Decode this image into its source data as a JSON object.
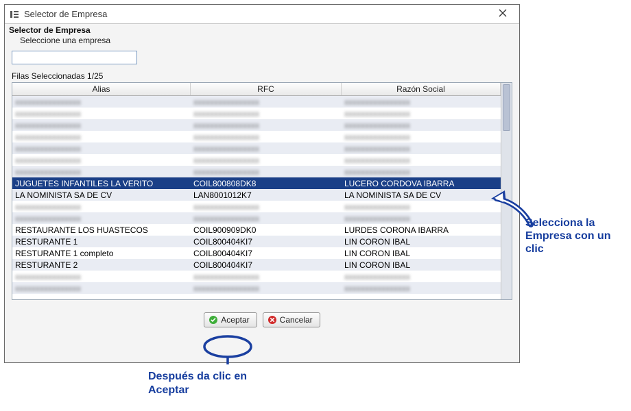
{
  "window": {
    "title": "Selector de Empresa",
    "subtitle": "Selector de Empresa",
    "instruction": "Seleccione una empresa"
  },
  "search": {
    "value": ""
  },
  "selected_count": "Filas Seleccionadas 1/25",
  "columns": {
    "alias": "Alias",
    "rfc": "RFC",
    "razon": "Razón Social"
  },
  "rows": [
    {
      "alias": "",
      "rfc": "",
      "razon": "",
      "blur": true
    },
    {
      "alias": "",
      "rfc": "",
      "razon": "",
      "blur": true
    },
    {
      "alias": "",
      "rfc": "",
      "razon": "",
      "blur": true
    },
    {
      "alias": "",
      "rfc": "",
      "razon": "",
      "blur": true
    },
    {
      "alias": "",
      "rfc": "",
      "razon": "",
      "blur": true
    },
    {
      "alias": "",
      "rfc": "",
      "razon": "",
      "blur": true
    },
    {
      "alias": "",
      "rfc": "",
      "razon": "",
      "blur": true
    },
    {
      "alias": "JUGUETES INFANTILES LA VERITO",
      "rfc": "COIL800808DK8",
      "razon": "LUCERO CORDOVA IBARRA",
      "selected": true
    },
    {
      "alias": "LA NOMINISTA SA DE CV",
      "rfc": "LAN8001012K7",
      "razon": "LA NOMINISTA SA DE CV"
    },
    {
      "alias": "",
      "rfc": "",
      "razon": "",
      "blur": true
    },
    {
      "alias": "",
      "rfc": "",
      "razon": "",
      "blur": true
    },
    {
      "alias": "RESTAURANTE LOS HUASTECOS",
      "rfc": "COIL900909DK0",
      "razon": "LURDES CORONA IBARRA"
    },
    {
      "alias": "RESTURANTE 1",
      "rfc": "COIL800404KI7",
      "razon": "LIN CORON IBAL"
    },
    {
      "alias": "RESTURANTE 1 completo",
      "rfc": "COIL800404KI7",
      "razon": "LIN CORON IBAL"
    },
    {
      "alias": "RESTURANTE 2",
      "rfc": "COIL800404KI7",
      "razon": "LIN CORON IBAL"
    },
    {
      "alias": "",
      "rfc": "",
      "razon": "",
      "blur": true
    },
    {
      "alias": "",
      "rfc": "",
      "razon": "",
      "blur": true
    }
  ],
  "buttons": {
    "accept": "Aceptar",
    "cancel": "Cancelar"
  },
  "annotations": {
    "select_company": "Selecciona la Empresa con un clic",
    "then_accept": "Después da clic en Aceptar"
  },
  "blur_placeholder": "xxxxxxxxxxxxxxxx"
}
